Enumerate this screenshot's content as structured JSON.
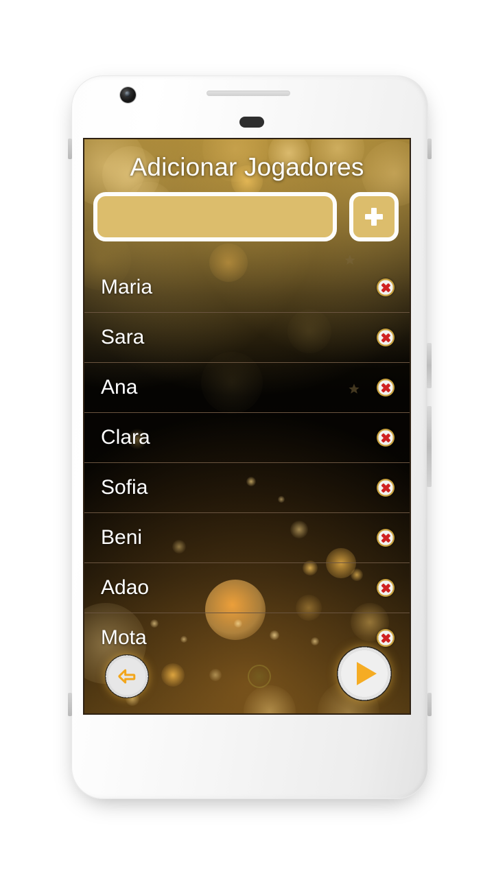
{
  "app": {
    "screen_title": "Adicionar Jogadores",
    "language": "pt-BR",
    "theme_accent": "#dcbd6c",
    "background_accent": "#f0b63c"
  },
  "add_player": {
    "input_value": "",
    "input_placeholder": "",
    "add_button_label": "+",
    "add_button_icon": "plus-icon"
  },
  "players": [
    {
      "name": "Maria",
      "delete_icon": "delete-circle-x-icon"
    },
    {
      "name": "Sara",
      "delete_icon": "delete-circle-x-icon"
    },
    {
      "name": "Ana",
      "delete_icon": "delete-circle-x-icon"
    },
    {
      "name": "Clara",
      "delete_icon": "delete-circle-x-icon"
    },
    {
      "name": "Sofia",
      "delete_icon": "delete-circle-x-icon"
    },
    {
      "name": "Beni",
      "delete_icon": "delete-circle-x-icon"
    },
    {
      "name": "Adao",
      "delete_icon": "delete-circle-x-icon"
    },
    {
      "name": "Mota",
      "delete_icon": "delete-circle-x-icon"
    }
  ],
  "navigation": {
    "back_icon": "arrow-left-icon",
    "play_icon": "play-triangle-icon"
  },
  "device": {
    "camera_icon": "front-camera-icon",
    "speaker_icon": "earpiece-speaker-icon",
    "sensor_icon": "proximity-sensor-icon"
  }
}
